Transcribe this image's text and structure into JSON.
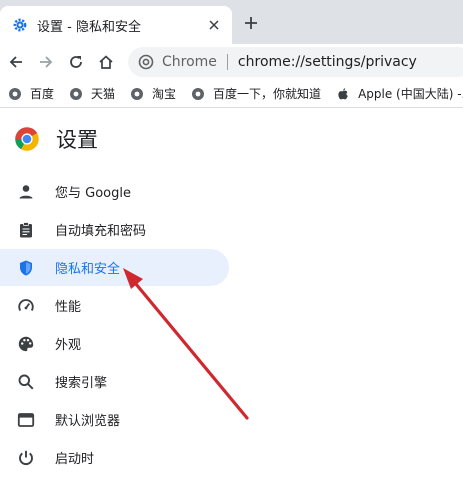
{
  "tab": {
    "title": "设置 - 隐私和安全"
  },
  "toolbar": {
    "site_label": "Chrome",
    "url": "chrome://settings/privacy"
  },
  "bookmarks": [
    {
      "label": "百度",
      "icon": "globe-icon"
    },
    {
      "label": "天猫",
      "icon": "globe-icon"
    },
    {
      "label": "淘宝",
      "icon": "globe-icon"
    },
    {
      "label": "百度一下，你就知道",
      "icon": "globe-icon"
    },
    {
      "label": "Apple (中国大陆) -...",
      "icon": "apple-icon"
    }
  ],
  "settings": {
    "title": "设置",
    "nav": [
      {
        "label": "您与 Google",
        "icon": "person-icon"
      },
      {
        "label": "自动填充和密码",
        "icon": "clipboard-icon"
      },
      {
        "label": "隐私和安全",
        "icon": "shield-icon",
        "active": true
      },
      {
        "label": "性能",
        "icon": "gauge-icon"
      },
      {
        "label": "外观",
        "icon": "palette-icon"
      },
      {
        "label": "搜索引擎",
        "icon": "search-icon"
      },
      {
        "label": "默认浏览器",
        "icon": "browser-icon"
      },
      {
        "label": "启动时",
        "icon": "power-icon"
      }
    ]
  },
  "colors": {
    "accent": "#1a73e8",
    "active_bg": "#e8f0fe",
    "annotation": "#d0282f"
  }
}
